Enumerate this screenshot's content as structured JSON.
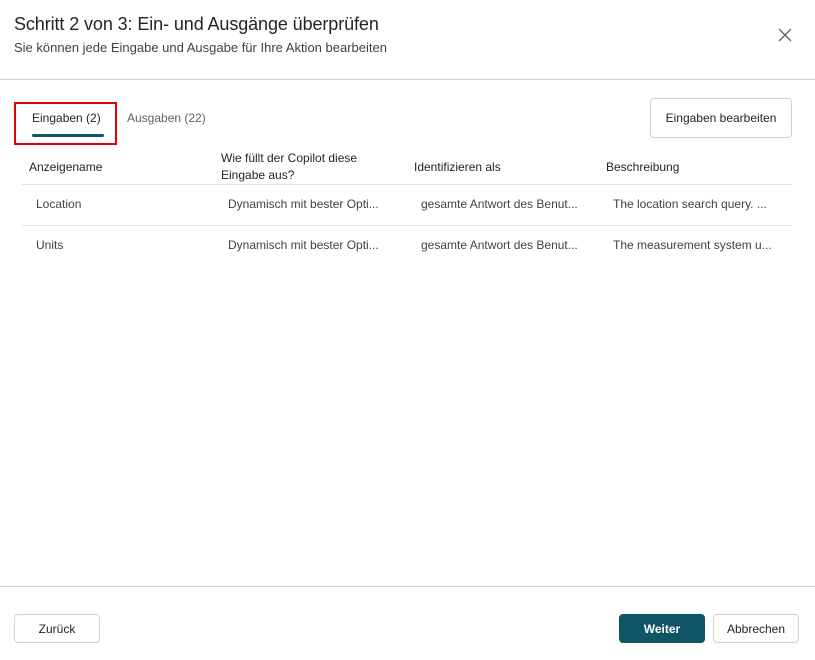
{
  "dialog": {
    "title": "Schritt 2 von 3: Ein- und Ausgänge überprüfen",
    "subtitle": "Sie können jede Eingabe und Ausgabe für Ihre Aktion bearbeiten",
    "close_icon": "close-icon"
  },
  "tabs": [
    {
      "label": "Eingaben (2)",
      "selected": true
    },
    {
      "label": "Ausgaben (22)",
      "selected": false
    }
  ],
  "toolbar": {
    "edit_label": "Eingaben bearbeiten"
  },
  "table": {
    "headers": [
      "Anzeigename",
      "Wie füllt der Copilot diese Eingabe aus?",
      "Identifizieren als",
      "Beschreibung"
    ],
    "rows": [
      [
        "Location",
        "Dynamisch mit bester Opti...",
        "gesamte Antwort des Benut...",
        "The location search query. ..."
      ],
      [
        "Units",
        "Dynamisch mit bester Opti...",
        "gesamte Antwort des Benut...",
        "The measurement system u..."
      ]
    ]
  },
  "footer": {
    "back_label": "Zurück",
    "next_label": "Weiter",
    "cancel_label": "Abbrechen"
  },
  "colors": {
    "accent": "#0f5565",
    "highlight": "#e00000"
  }
}
